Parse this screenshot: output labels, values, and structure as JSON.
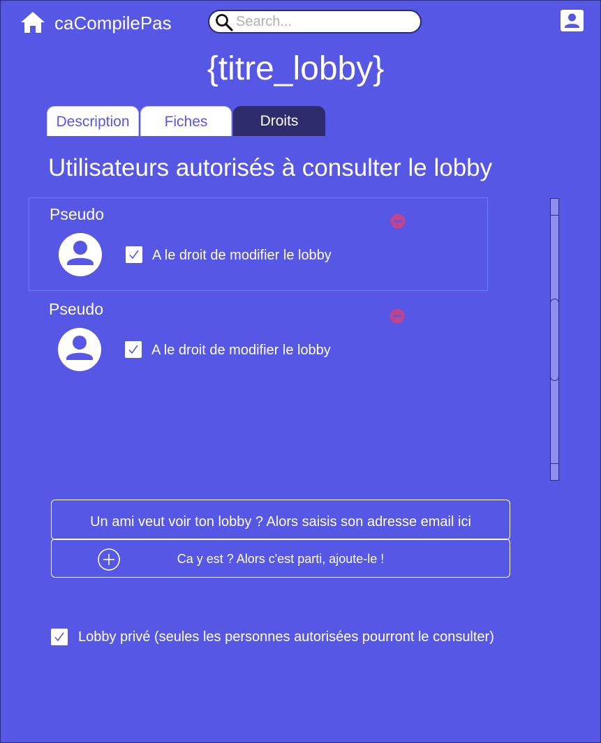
{
  "header": {
    "app_name": "caCompilePas",
    "search_placeholder": "Search...",
    "home_icon": "home-icon",
    "user_icon": "user-account-icon"
  },
  "lobby": {
    "title": "{titre_lobby}"
  },
  "tabs": [
    {
      "label": "Description",
      "active": false
    },
    {
      "label": "Fiches",
      "active": false
    },
    {
      "label": "Droits",
      "active": true
    }
  ],
  "section_title": "Utilisateurs autorisés à consulter le lobby",
  "users": [
    {
      "pseudo": "Pseudo",
      "permission_label": "A le droit de modifier le lobby",
      "can_edit": true,
      "selected": true
    },
    {
      "pseudo": "Pseudo",
      "permission_label": "A le droit de modifier le lobby",
      "can_edit": true,
      "selected": false
    }
  ],
  "invite": {
    "email_prompt": "Un ami veut voir ton lobby ? Alors saisis son adresse email ici",
    "add_label": "Ca y est ? Alors c'est parti, ajoute-le !"
  },
  "private_option": {
    "checked": true,
    "label": "Lobby privé (seules les personnes autorisées pourront le consulter)"
  },
  "colors": {
    "background": "#5757e6",
    "active_tab": "#2d2d6e",
    "remove_icon": "#c2448a",
    "text": "#ffffff"
  }
}
